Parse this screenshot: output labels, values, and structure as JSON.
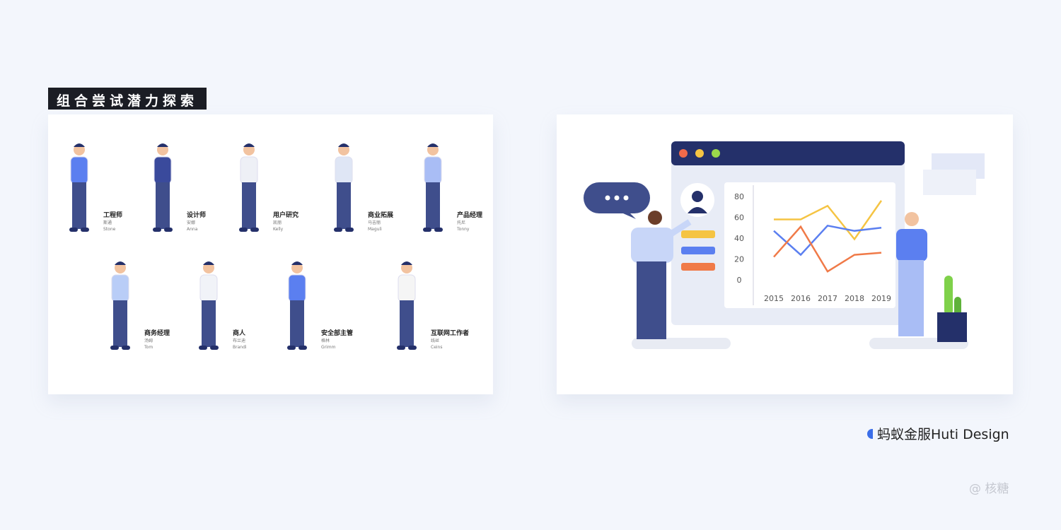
{
  "title": "组合尝试潜力探索",
  "people": [
    {
      "role": "工程师",
      "cn": "斯通",
      "en": "Stone",
      "color": "#5b7ff0"
    },
    {
      "role": "设计师",
      "cn": "安娜",
      "en": "Anna",
      "color": "#3a4a9c"
    },
    {
      "role": "用户研究",
      "cn": "凯丽",
      "en": "Kelly",
      "color": "#eef0f6"
    },
    {
      "role": "商业拓展",
      "cn": "马吉丽",
      "en": "Maguli",
      "color": "#dfe6f5"
    },
    {
      "role": "产品经理",
      "cn": "托尼",
      "en": "Tonny",
      "color": "#a9bdf5"
    },
    {
      "role": "商务经理",
      "cn": "汤姆",
      "en": "Tom",
      "color": "#b9cdf7"
    },
    {
      "role": "商人",
      "cn": "布兰迪",
      "en": "Brandi",
      "color": "#f1f3f8"
    },
    {
      "role": "安全部主管",
      "cn": "格林",
      "en": "Grimm",
      "color": "#5b7ff0"
    },
    {
      "role": "互联网工作者",
      "cn": "线丝",
      "en": "Ceins",
      "color": "#f5f5f5"
    }
  ],
  "brand": "蚂蚁金服Huti Design",
  "watermark": "@ 核糖",
  "chart_data": {
    "type": "line",
    "categories": [
      "2015",
      "2016",
      "2017",
      "2018",
      "2019"
    ],
    "ylim": [
      0,
      80
    ],
    "yticks": [
      "0",
      "20",
      "40",
      "60",
      "80"
    ],
    "grid": false,
    "series": [
      {
        "color": "#f5c443",
        "values": [
          58,
          58,
          71,
          39,
          76
        ]
      },
      {
        "color": "#5b7ff0",
        "values": [
          47,
          24,
          52,
          47,
          50
        ]
      },
      {
        "color": "#f07a48",
        "values": [
          22,
          51,
          8,
          24,
          26
        ]
      }
    ]
  },
  "colors": {
    "window_bar": "#24306a",
    "dot_red": "#f06a4a",
    "dot_yellow": "#f5c443",
    "dot_green": "#9bd84b",
    "accent": "#3b6ee8"
  }
}
